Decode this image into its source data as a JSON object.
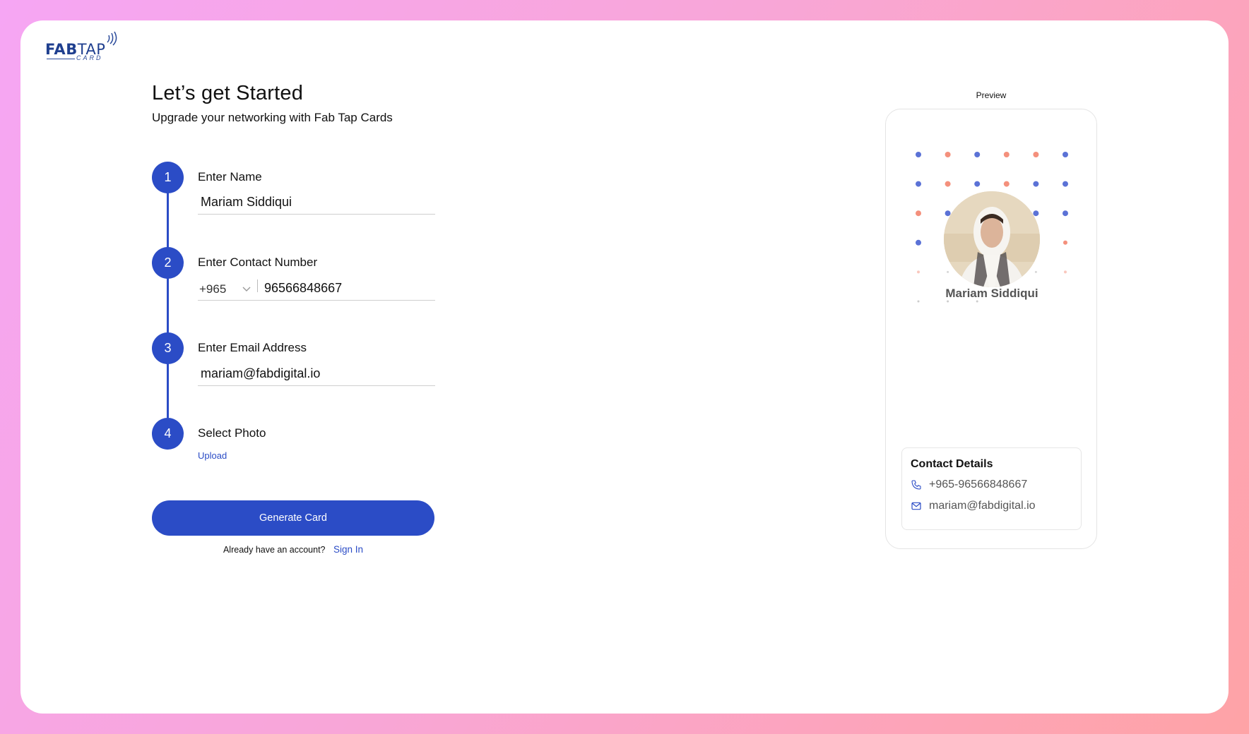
{
  "brand": {
    "logo_bold": "FAB",
    "logo_light": "TAP",
    "logo_sub": "CARD"
  },
  "header": {
    "title": "Let’s get Started",
    "subtitle": "Upgrade your networking with Fab Tap Cards"
  },
  "steps": [
    {
      "number": "1",
      "label": "Enter Name",
      "value": "Mariam Siddiqui"
    },
    {
      "number": "2",
      "label": "Enter Contact Number",
      "country_code": "+965",
      "value": "96566848667"
    },
    {
      "number": "3",
      "label": "Enter Email Address",
      "value": "mariam@fabdigital.io"
    },
    {
      "number": "4",
      "label": "Select Photo",
      "action": "Upload"
    }
  ],
  "actions": {
    "generate_label": "Generate Card",
    "account_prompt": "Already have an account?",
    "signin_label": "Sign In"
  },
  "preview": {
    "label": "Preview",
    "name": "Mariam Siddiqui",
    "contact_title": "Contact Details",
    "phone": "+965-96566848667",
    "email": "mariam@fabdigital.io",
    "icons": {
      "phone": "phone-icon",
      "email": "mail-icon"
    }
  },
  "colors": {
    "accent": "#2b4cc6",
    "dot_blue": "#5b72d6",
    "dot_salmon": "#f4907c",
    "logo": "#1f3f8f"
  }
}
